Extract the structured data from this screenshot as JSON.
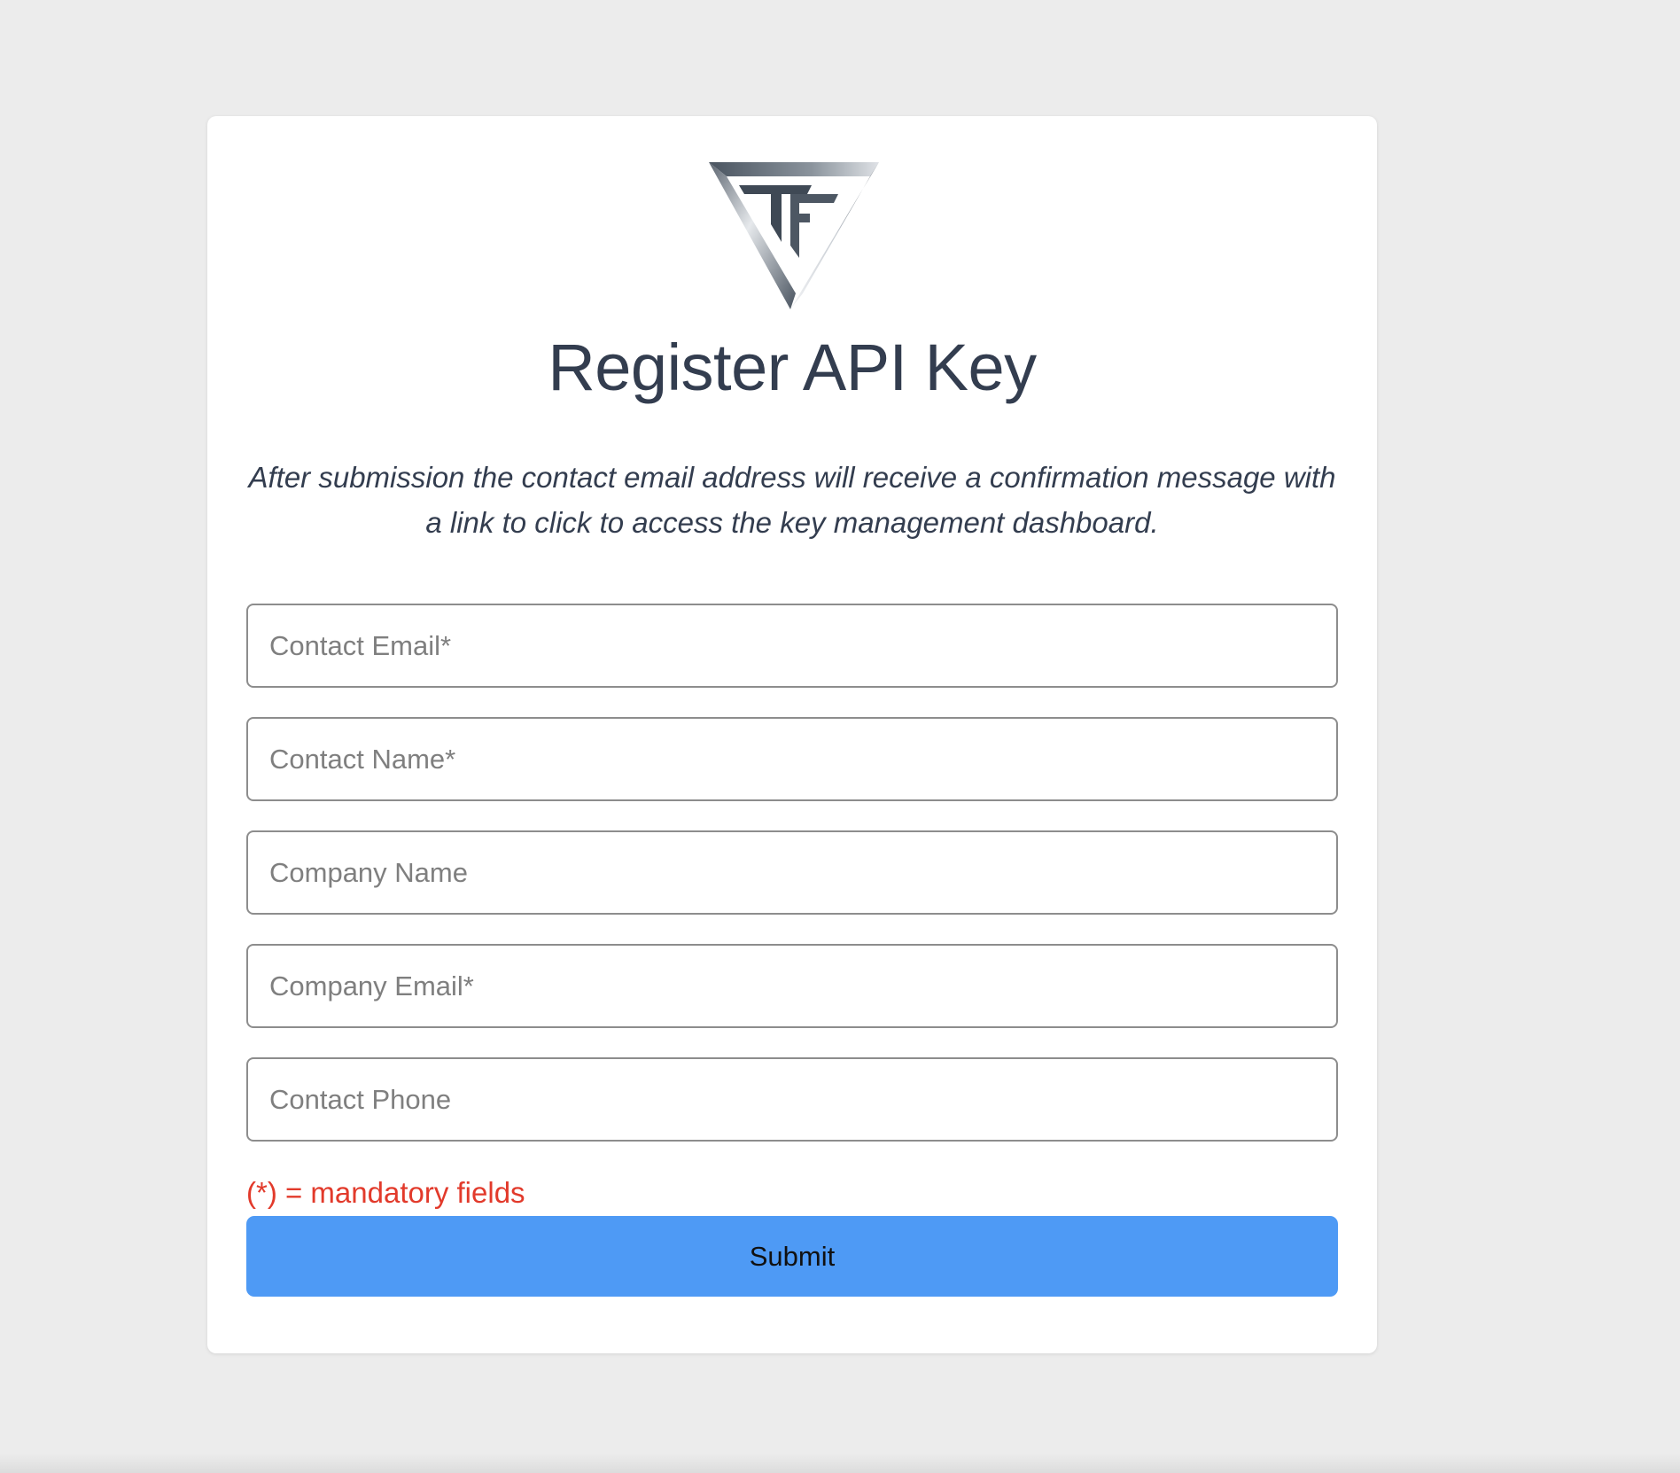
{
  "brand": {
    "logo_icon": "tf-triangle-logo-icon"
  },
  "page": {
    "title": "Register API Key",
    "subtitle": "After submission the contact email address will receive a confirmation message with a link to click to access the key management dashboard."
  },
  "form": {
    "fields": [
      {
        "placeholder": "Contact Email*",
        "value": ""
      },
      {
        "placeholder": "Contact Name*",
        "value": ""
      },
      {
        "placeholder": "Company Name",
        "value": ""
      },
      {
        "placeholder": "Company Email*",
        "value": ""
      },
      {
        "placeholder": "Contact Phone",
        "value": ""
      }
    ],
    "mandatory_note": "(*) = mandatory fields",
    "submit_label": "Submit"
  },
  "colors": {
    "background": "#ececec",
    "card": "#ffffff",
    "title_text": "#333d4f",
    "mandatory_note": "#e23a2b",
    "submit_button": "#4e9af5"
  }
}
